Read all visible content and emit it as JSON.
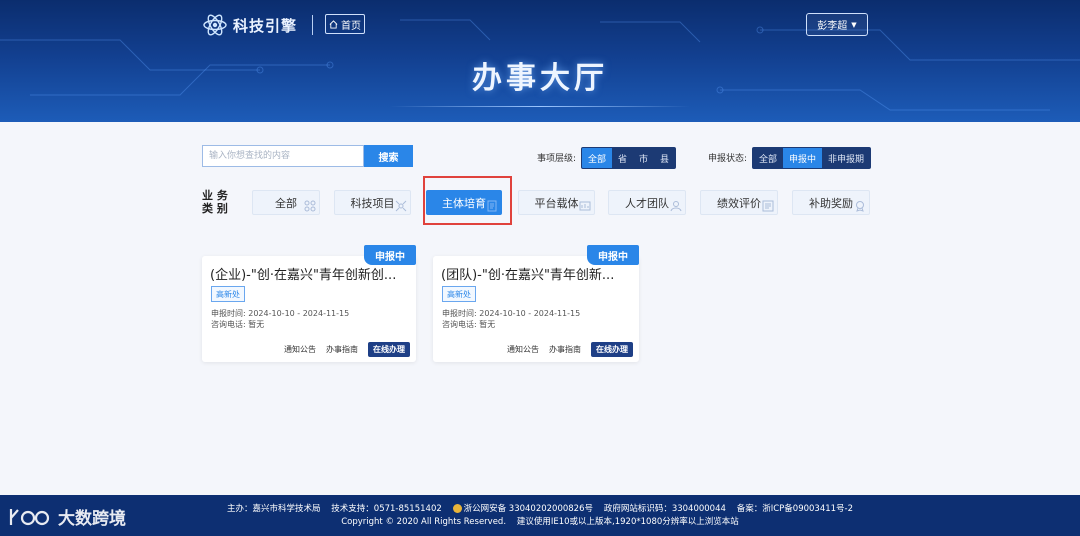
{
  "header": {
    "logo_text": "科技引擎",
    "home_label": "首页",
    "user_name": "彭李超",
    "hall_title": "办事大厅"
  },
  "search": {
    "placeholder": "输入你想查找的内容",
    "button_label": "搜索"
  },
  "filters": {
    "level_label": "事项层级:",
    "level_options": [
      "全部",
      "省",
      "市",
      "县"
    ],
    "level_selected": "全部",
    "status_label": "申报状态:",
    "status_options": [
      "全部",
      "申报中",
      "非申报期"
    ],
    "status_selected": "申报中"
  },
  "categories": {
    "label": "业务类别:",
    "label_line1": "业 务",
    "label_line2": "类 别",
    "items": [
      "全部",
      "科技项目",
      "主体培育",
      "平台载体",
      "人才团队",
      "绩效评价",
      "补助奖励"
    ],
    "selected": "主体培育"
  },
  "cards": [
    {
      "badge": "申报中",
      "title": "(企业)-\"创·在嘉兴\"青年创新创...",
      "tag": "高新处",
      "time_label": "申报时间:",
      "time_value": "2024-10-10 - 2024-11-15",
      "phone_label": "咨询电话:",
      "phone_value": "暂无",
      "notice_label": "通知公告",
      "guide_label": "办事指南",
      "online_label": "在线办理"
    },
    {
      "badge": "申报中",
      "title": "(团队)-\"创·在嘉兴\"青年创新...",
      "tag": "高新处",
      "time_label": "申报时间:",
      "time_value": "2024-10-10 - 2024-11-15",
      "phone_label": "咨询电话:",
      "phone_value": "暂无",
      "notice_label": "通知公告",
      "guide_label": "办事指南",
      "online_label": "在线办理"
    }
  ],
  "footer": {
    "sponsor": "主办：嘉兴市科学技术局",
    "support": "技术支持：0571-85151402",
    "police": "浙公网安备 33040202000826号",
    "site_id": "政府网站标识码：3304000044",
    "icp": "备案：浙ICP备09003411号-2",
    "copyright": "Copyright © 2020 All Rights Reserved.",
    "browser_tip": "建议使用IE10或以上版本,1920*1080分辨率以上浏览本站"
  },
  "watermark_text": "大数跨境",
  "colors": {
    "accent": "#2a86e8",
    "header_dark": "#0b2d6e",
    "footer": "#0d2f72",
    "highlight_red": "#e0423c"
  }
}
